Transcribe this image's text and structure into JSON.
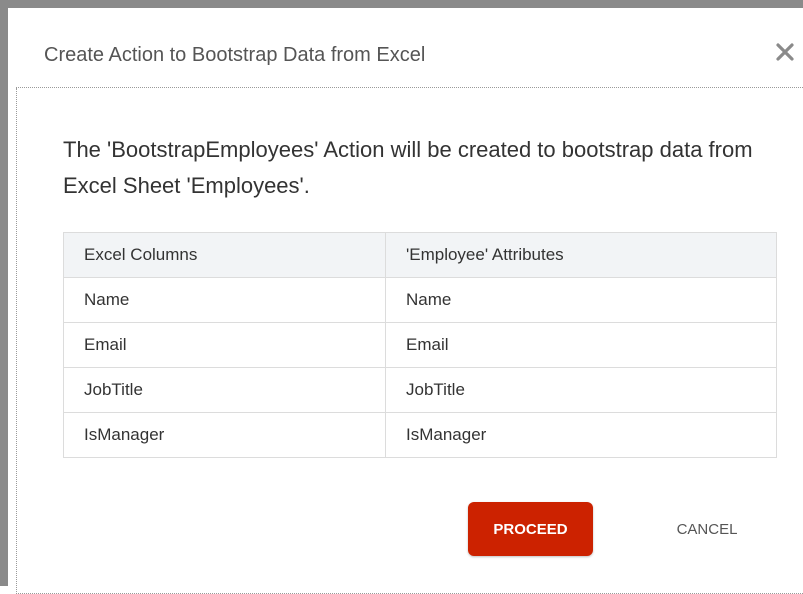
{
  "dialog": {
    "title": "Create Action to Bootstrap Data from Excel",
    "close_icon": "close-icon",
    "message": "The 'BootstrapEmployees' Action will be created to bootstrap data from Excel Sheet 'Employees'."
  },
  "mapping_table": {
    "headers": [
      "Excel Columns",
      "'Employee' Attributes"
    ],
    "rows": [
      [
        "Name",
        "Name"
      ],
      [
        "Email",
        "Email"
      ],
      [
        "JobTitle",
        "JobTitle"
      ],
      [
        "IsManager",
        "IsManager"
      ]
    ]
  },
  "actions": {
    "proceed_label": "PROCEED",
    "cancel_label": "CANCEL"
  },
  "colors": {
    "primary": "#cc2200",
    "header_bg": "#f2f4f6",
    "border": "#dcdcdc"
  }
}
